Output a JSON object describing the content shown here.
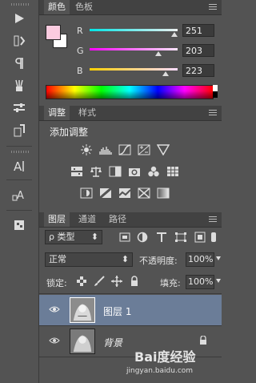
{
  "color_panel": {
    "tabs": [
      "颜色",
      "色板"
    ],
    "channels": [
      {
        "label": "R",
        "value": "251",
        "level": 0.98,
        "gradient": "linear-gradient(90deg,#00e6e6,#f0f0f0)"
      },
      {
        "label": "G",
        "value": "203",
        "level": 0.8,
        "gradient": "linear-gradient(90deg,#ff00ff,#fce8ff)"
      },
      {
        "label": "B",
        "value": "223",
        "level": 0.87,
        "gradient": "linear-gradient(90deg,#ffcc00,#fce0ff)"
      }
    ],
    "foreground": "#fbcbdf",
    "background": "#ffffff"
  },
  "adjust_panel": {
    "tabs": [
      "调整",
      "样式"
    ],
    "heading": "添加调整",
    "row1_icons": [
      "brightness-contrast-icon",
      "levels-icon",
      "curves-icon",
      "exposure-icon",
      "vibrance-icon"
    ],
    "row2_icons": [
      "hue-saturation-icon",
      "color-balance-icon",
      "black-white-icon",
      "photo-filter-icon",
      "channel-mixer-icon",
      "color-lookup-icon"
    ],
    "row3_icons": [
      "invert-icon",
      "posterize-icon",
      "threshold-icon",
      "selective-color-icon",
      "gradient-map-icon"
    ]
  },
  "layers_panel": {
    "tabs": [
      "图层",
      "通道",
      "路径"
    ],
    "filter_label": "ρ 类型",
    "blend_mode": "正常",
    "opacity_label": "不透明度:",
    "opacity_value": "100%",
    "lock_label": "锁定:",
    "fill_label": "填充:",
    "fill_value": "100%",
    "layers": [
      {
        "name": "图层 1",
        "selected": true
      },
      {
        "name": "背景",
        "selected": false
      }
    ]
  },
  "watermark": {
    "logo": "Bai度经验",
    "url": "jingyan.baidu.com"
  }
}
